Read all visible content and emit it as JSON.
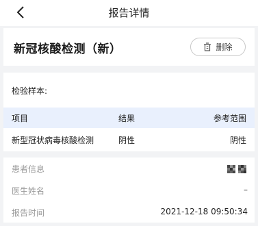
{
  "nav": {
    "title": "报告详情",
    "back_icon": "chevron-left-icon"
  },
  "header": {
    "title": "新冠核酸检测（新）",
    "delete_label": "删除",
    "delete_icon": "trash-icon"
  },
  "sample": {
    "label": "检验样本:",
    "columns": [
      "项目",
      "结果",
      "参考范围"
    ],
    "rows": [
      {
        "item": "新型冠状病毒核酸检测",
        "result": "阴性",
        "reference": "阴性"
      }
    ]
  },
  "info": {
    "patient_label": "患者信息",
    "doctor_label": "医生姓名",
    "doctor_value": "–",
    "time_label": "报告时间",
    "time_value": "2021-12-18 09:50:34"
  },
  "colors": {
    "table_header_bg": "#e9f0fd",
    "page_bg": "#f2f3f5"
  }
}
